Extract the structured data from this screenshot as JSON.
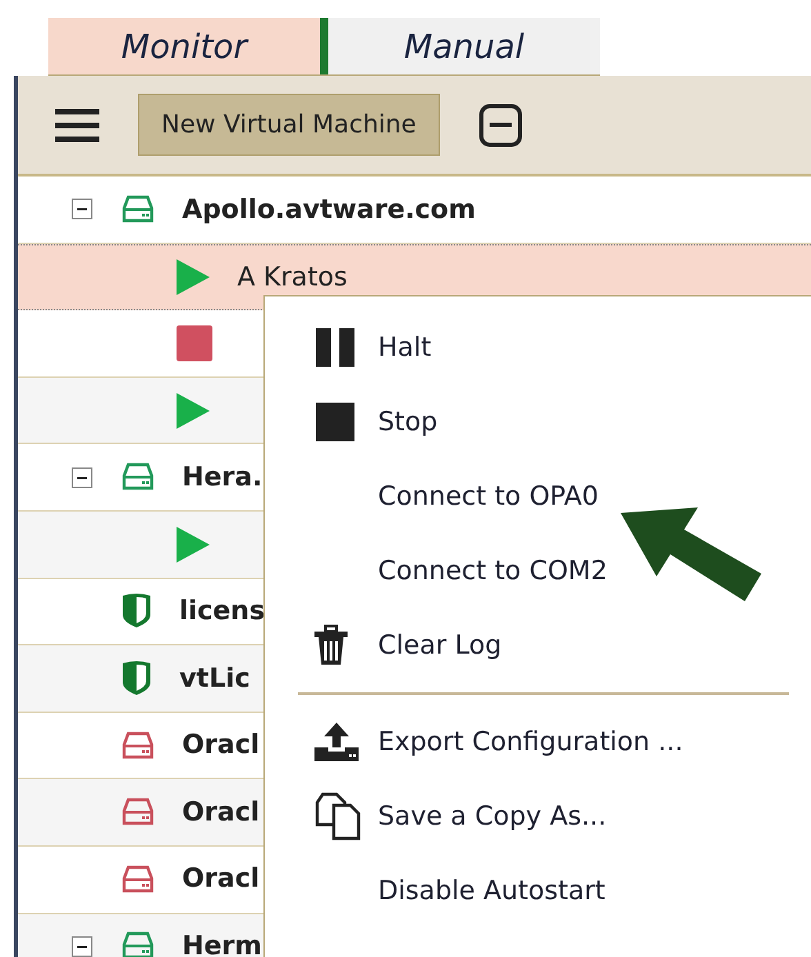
{
  "tabs": [
    {
      "label": "Monitor",
      "selected": true
    },
    {
      "label": "Manual",
      "selected": false
    }
  ],
  "toolbar": {
    "button": "New Virtual Machine"
  },
  "tree": [
    {
      "kind": "server",
      "label": "Apollo.avtware.com",
      "color": "#22995a",
      "expanded": true,
      "selected": false,
      "children": [
        {
          "kind": "running",
          "label": "A Kratos",
          "selected": true
        },
        {
          "kind": "stopped",
          "selected": false
        },
        {
          "kind": "running",
          "selected": false
        }
      ]
    },
    {
      "kind": "server",
      "label": "Hera.",
      "color": "#22995a",
      "expanded": true,
      "selected": false,
      "children": [
        {
          "kind": "running",
          "selected": false
        }
      ]
    },
    {
      "kind": "license",
      "label": "licens",
      "selected": false
    },
    {
      "kind": "license",
      "label": "vtLic",
      "selected": false
    },
    {
      "kind": "server",
      "label": "Oracl",
      "color": "#c9505c",
      "selected": false
    },
    {
      "kind": "server",
      "label": "Oracl",
      "color": "#c9505c",
      "selected": false
    },
    {
      "kind": "server",
      "label": "Oracl",
      "color": "#c9505c",
      "selected": false
    },
    {
      "kind": "server",
      "label": "Herm",
      "color": "#22995a",
      "expanded": true,
      "selected": false
    }
  ],
  "context_menu": [
    {
      "kind": "pause",
      "label": "Halt"
    },
    {
      "kind": "stop",
      "label": "Stop"
    },
    {
      "kind": "plain",
      "label": "Connect to OPA0"
    },
    {
      "kind": "plain",
      "label": "Connect to COM2"
    },
    {
      "kind": "trash",
      "label": "Clear Log"
    },
    {
      "kind": "separator"
    },
    {
      "kind": "export",
      "label": "Export Configuration ..."
    },
    {
      "kind": "copy",
      "label": "Save a Copy As..."
    },
    {
      "kind": "plain",
      "label": "Disable Autostart"
    }
  ]
}
